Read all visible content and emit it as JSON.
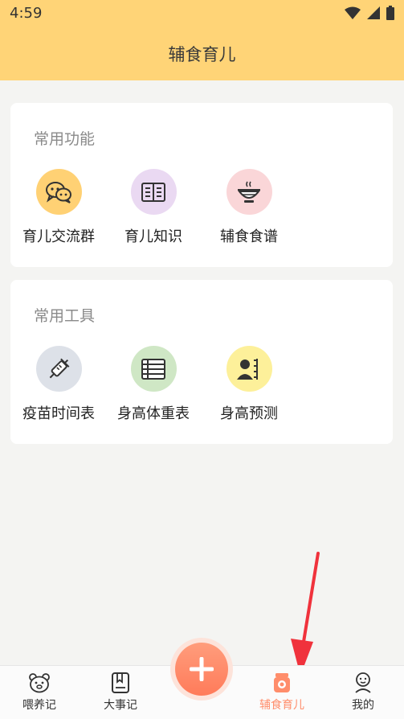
{
  "status_bar": {
    "time": "4:59"
  },
  "header": {
    "title": "辅食育儿"
  },
  "sections": [
    {
      "title": "常用功能",
      "items": [
        {
          "label": "育儿交流群",
          "icon": "chat-bubbles-icon",
          "color": "#ffd174"
        },
        {
          "label": "育儿知识",
          "icon": "open-book-icon",
          "color": "#ead9f2"
        },
        {
          "label": "辅食食谱",
          "icon": "bowl-icon",
          "color": "#fad6d8"
        }
      ]
    },
    {
      "title": "常用工具",
      "items": [
        {
          "label": "疫苗时间表",
          "icon": "syringe-icon",
          "color": "#dde1e8"
        },
        {
          "label": "身高体重表",
          "icon": "table-icon",
          "color": "#cfe7c5"
        },
        {
          "label": "身高预测",
          "icon": "person-height-icon",
          "color": "#fdf09a"
        }
      ]
    }
  ],
  "bottom_nav": {
    "items": [
      {
        "label": "喂养记",
        "icon": "bear-face-icon"
      },
      {
        "label": "大事记",
        "icon": "notebook-icon"
      },
      {
        "label": "辅食育儿",
        "icon": "jar-icon",
        "active": true
      },
      {
        "label": "我的",
        "icon": "profile-face-icon"
      }
    ],
    "active_color": "#ff8d6b"
  },
  "fab": {
    "icon": "plus-icon"
  }
}
